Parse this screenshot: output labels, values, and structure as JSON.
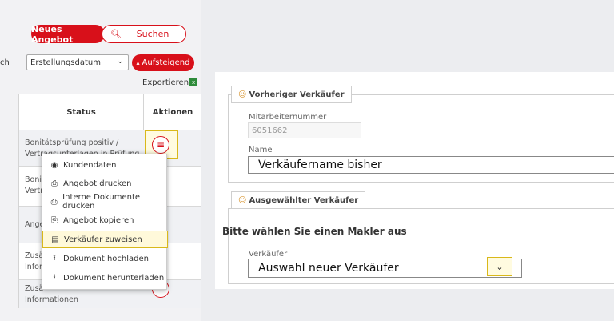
{
  "toolbar": {
    "new_offer_label": "Neues Angebot",
    "search_label": "Suchen",
    "sort_prefix": "ch",
    "sort_select_value": "Erstellungsdatum",
    "sort_order_label": "Aufsteigend",
    "export_label": "Exportieren"
  },
  "table": {
    "headers": [
      "Status",
      "Aktionen"
    ],
    "rows": [
      {
        "status_lines": [
          "Bonitätsprüfung positiv /",
          "Vertragsunterlagen in Prüfung"
        ]
      },
      {
        "status_lines": [
          "Boni",
          "Vertr"
        ]
      },
      {
        "status_lines": [
          "Ange"
        ]
      },
      {
        "status_lines": [
          "Zusä",
          "Inforr"
        ]
      },
      {
        "status_lines": [
          "Zusä",
          "Informationen"
        ]
      }
    ]
  },
  "action_menu": {
    "items": [
      {
        "label": "Kundendaten",
        "icon": "eye-icon"
      },
      {
        "label": "Angebot drucken",
        "icon": "printer-icon"
      },
      {
        "label": "Interne Dokumente drucken",
        "icon": "printer-icon"
      },
      {
        "label": "Angebot kopieren",
        "icon": "copy-icon"
      },
      {
        "label": "Verkäufer zuweisen",
        "icon": "id-card-icon",
        "highlighted": true
      },
      {
        "label": "Dokument hochladen",
        "icon": "upload-icon"
      },
      {
        "label": "Dokument herunterladen",
        "icon": "download-icon"
      }
    ]
  },
  "previous_seller": {
    "legend": "Vorheriger Verkäufer",
    "employee_number_label": "Mitarbeiternummer",
    "employee_number_value": "6051662",
    "name_label": "Name",
    "name_value": "Verkäufername bisher"
  },
  "selected_seller": {
    "legend": "Ausgewählter Verkäufer",
    "heading": "Bitte wählen Sie einen Makler aus",
    "seller_label": "Verkäufer",
    "seller_value": "Auswahl neuer Verkäufer"
  },
  "colors": {
    "brand_red": "#d8101a",
    "highlight_yellow": "#d9b81a"
  }
}
